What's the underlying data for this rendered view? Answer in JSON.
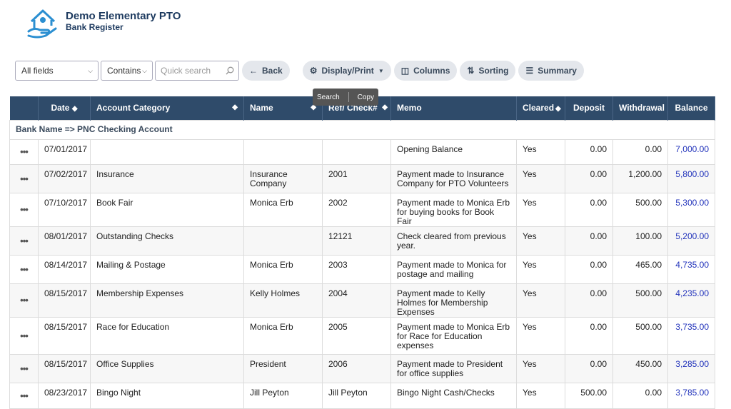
{
  "header": {
    "org_title": "Demo Elementary PTO",
    "page_subtitle": "Bank Register"
  },
  "toolbar": {
    "field_select": "All fields",
    "operator_select": "Contains",
    "search_placeholder": "Quick search",
    "back_label": "Back",
    "display_print_label": "Display/Print",
    "columns_label": "Columns",
    "sorting_label": "Sorting",
    "summary_label": "Summary"
  },
  "tooltip": {
    "search": "Search",
    "copy": "Copy"
  },
  "table": {
    "columns": [
      "Date",
      "Account Category",
      "Name",
      "Ref/ Check#",
      "Memo",
      "Cleared",
      "Deposit",
      "Withdrawal",
      "Balance"
    ],
    "group_label": "Bank Name => PNC Checking Account",
    "rows": [
      {
        "date": "07/01/2017",
        "category": "",
        "name": "",
        "ref": "",
        "memo": "Opening Balance",
        "cleared": "Yes",
        "deposit": "0.00",
        "withdrawal": "0.00",
        "balance": "7,000.00"
      },
      {
        "date": "07/02/2017",
        "category": "Insurance",
        "name": "Insurance Company",
        "ref": "2001",
        "memo": "Payment made to Insurance Company for PTO Volunteers",
        "cleared": "Yes",
        "deposit": "0.00",
        "withdrawal": "1,200.00",
        "balance": "5,800.00"
      },
      {
        "date": "07/10/2017",
        "category": "Book Fair",
        "name": "Monica Erb",
        "ref": "2002",
        "memo": "Payment made to Monica Erb for buying books for Book Fair",
        "cleared": "Yes",
        "deposit": "0.00",
        "withdrawal": "500.00",
        "balance": "5,300.00"
      },
      {
        "date": "08/01/2017",
        "category": "Outstanding Checks",
        "name": "",
        "ref": "12121",
        "memo": "Check cleared from previous year.",
        "cleared": "Yes",
        "deposit": "0.00",
        "withdrawal": "100.00",
        "balance": "5,200.00"
      },
      {
        "date": "08/14/2017",
        "category": "Mailing & Postage",
        "name": "Monica Erb",
        "ref": "2003",
        "memo": "Payment made to Monica for postage and mailing",
        "cleared": "Yes",
        "deposit": "0.00",
        "withdrawal": "465.00",
        "balance": "4,735.00"
      },
      {
        "date": "08/15/2017",
        "category": "Membership Expenses",
        "name": "Kelly Holmes",
        "ref": "2004",
        "memo": "Payment made to Kelly Holmes for Membership Expenses",
        "cleared": "Yes",
        "deposit": "0.00",
        "withdrawal": "500.00",
        "balance": "4,235.00"
      },
      {
        "date": "08/15/2017",
        "category": "Race for Education",
        "name": "Monica Erb",
        "ref": "2005",
        "memo": "Payment made to Monica Erb for Race for Education expenses",
        "cleared": "Yes",
        "deposit": "0.00",
        "withdrawal": "500.00",
        "balance": "3,735.00"
      },
      {
        "date": "08/15/2017",
        "category": "Office Supplies",
        "name": "President",
        "ref": "2006",
        "memo": "Payment made to President for office supplies",
        "cleared": "Yes",
        "deposit": "0.00",
        "withdrawal": "450.00",
        "balance": "3,285.00"
      },
      {
        "date": "08/23/2017",
        "category": "Bingo Night",
        "name": "Jill Peyton",
        "ref": "Jill Peyton",
        "memo": "Bingo Night Cash/Checks",
        "cleared": "Yes",
        "deposit": "500.00",
        "withdrawal": "0.00",
        "balance": "3,785.00"
      }
    ]
  }
}
